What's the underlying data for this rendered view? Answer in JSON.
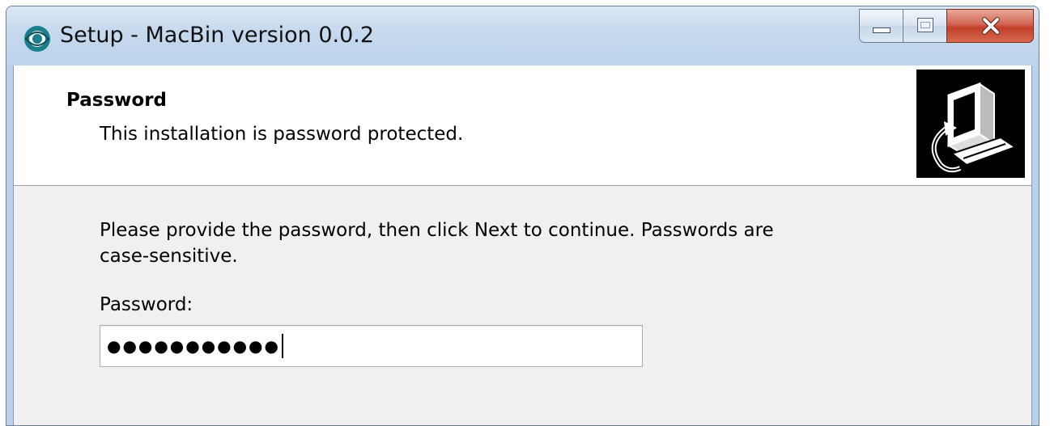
{
  "window": {
    "title": "Setup - MacBin version 0.0.2",
    "icon": "setup-app-icon",
    "controls": [
      "minimize-icon",
      "maximize-icon",
      "close-icon"
    ]
  },
  "header": {
    "title": "Password",
    "subtitle": "This installation is password protected.",
    "image": "computer-setup-icon"
  },
  "main": {
    "instructions": "Please provide the password, then click Next to continue. Passwords are case-sensitive.",
    "password_label": "Password:",
    "password_value": "●●●●●●●●●●●"
  },
  "colors": {
    "titlebar": "#c6d9ee",
    "close_button": "#c2402a",
    "panel_background": "#f0f0f0",
    "header_background": "#ffffff"
  }
}
